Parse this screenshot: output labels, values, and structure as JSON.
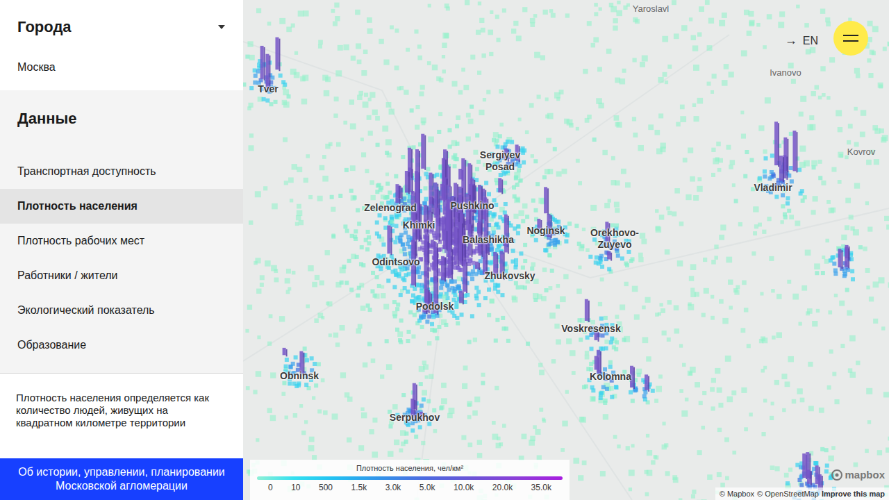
{
  "sidebar": {
    "cities_header": {
      "title": "Города",
      "expanded": false
    },
    "city": "Москва",
    "data_header": "Данные",
    "data_items": [
      {
        "label": "Транспортная доступность",
        "selected": false
      },
      {
        "label": "Плотность населения",
        "selected": true
      },
      {
        "label": "Плотность рабочих мест",
        "selected": false
      },
      {
        "label": "Работники / жители",
        "selected": false
      },
      {
        "label": "Экологический показатель",
        "selected": false
      },
      {
        "label": "Образование",
        "selected": false
      }
    ],
    "description": "Плотность населения определяется как количество людей, живущих на квадратном километре территории",
    "about_link": "Об истории, управлении, планировании Московской агломерации"
  },
  "map": {
    "labels": [
      {
        "text": "Yaroslavl",
        "kind": "minor"
      },
      {
        "text": "Ivanovo",
        "kind": "minor"
      },
      {
        "text": "Kovrov",
        "kind": "minor"
      },
      {
        "text": "Vladimir",
        "kind": "major"
      },
      {
        "text": "Tver",
        "kind": "major"
      },
      {
        "text": "Sergiyev Posad",
        "kind": "major"
      },
      {
        "text": "Zelenograd",
        "kind": "major"
      },
      {
        "text": "Pushkino",
        "kind": "major"
      },
      {
        "text": "Khimki",
        "kind": "major"
      },
      {
        "text": "Balashikha",
        "kind": "major"
      },
      {
        "text": "Noginsk",
        "kind": "major"
      },
      {
        "text": "Orekhovo-Zuyevo",
        "kind": "major"
      },
      {
        "text": "Odintsovo",
        "kind": "major"
      },
      {
        "text": "Zhukovsky",
        "kind": "major"
      },
      {
        "text": "Podolsk",
        "kind": "major"
      },
      {
        "text": "Voskresensk",
        "kind": "major"
      },
      {
        "text": "Obninsk",
        "kind": "major"
      },
      {
        "text": "Kolomna",
        "kind": "major"
      },
      {
        "text": "Serpukhov",
        "kind": "major"
      }
    ],
    "language_switch": {
      "arrow": "→",
      "label": "EN"
    },
    "legend": {
      "title": "Плотность населения, чел/км²",
      "ticks": [
        "0",
        "10",
        "500",
        "1.5k",
        "3.0k",
        "5.0k",
        "10.0k",
        "20.0k",
        "35.0k"
      ]
    },
    "logo": "mapbox",
    "attribution": [
      "© Mapbox",
      "© OpenStreetMap",
      "Improve this map"
    ]
  }
}
